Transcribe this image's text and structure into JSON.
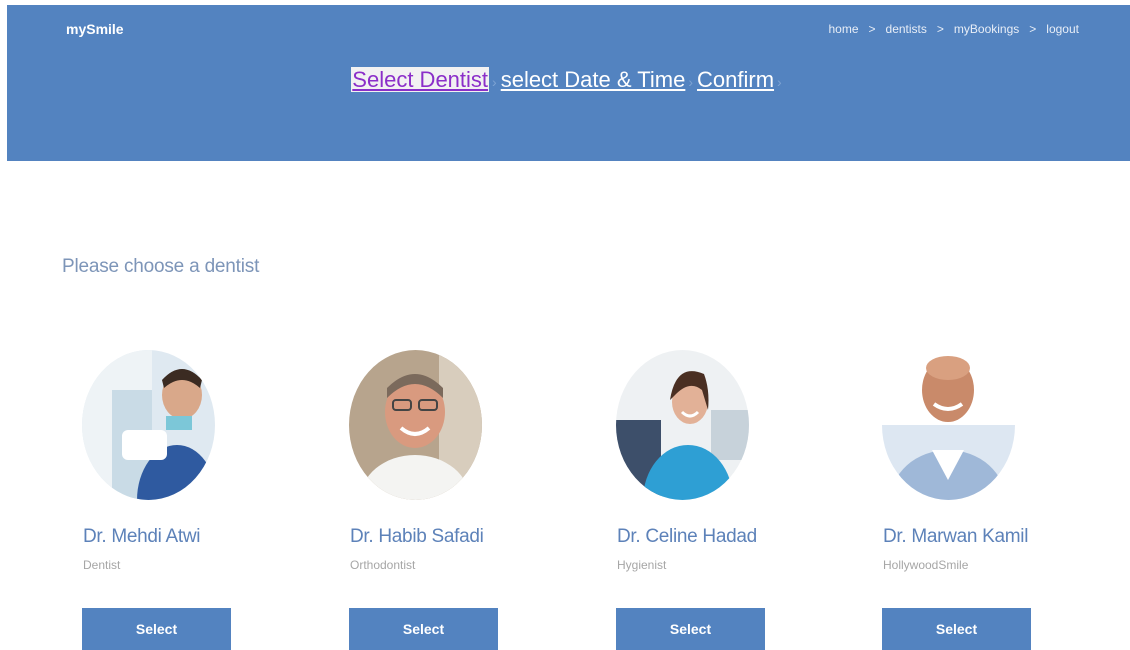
{
  "brand": "mySmile",
  "nav": {
    "items": [
      "home",
      "dentists",
      "myBookings",
      "logout"
    ],
    "separator": ">"
  },
  "steps": {
    "items": [
      "Select Dentist",
      "select Date & Time",
      "Confirm"
    ],
    "arrow": "›"
  },
  "prompt": "Please choose a dentist",
  "dentists": [
    {
      "name": "Dr. Mehdi Atwi",
      "role": "Dentist",
      "button": "Select"
    },
    {
      "name": "Dr. Habib Safadi",
      "role": "Orthodontist",
      "button": "Select"
    },
    {
      "name": "Dr. Celine Hadad",
      "role": "Hygienist",
      "button": "Select"
    },
    {
      "name": "Dr. Marwan Kamil",
      "role": "HollywoodSmile",
      "button": "Select"
    }
  ],
  "colors": {
    "header": "#5383c0",
    "button": "#5383c0",
    "name": "#5d82b9",
    "active_step": "#8b2fc9"
  }
}
